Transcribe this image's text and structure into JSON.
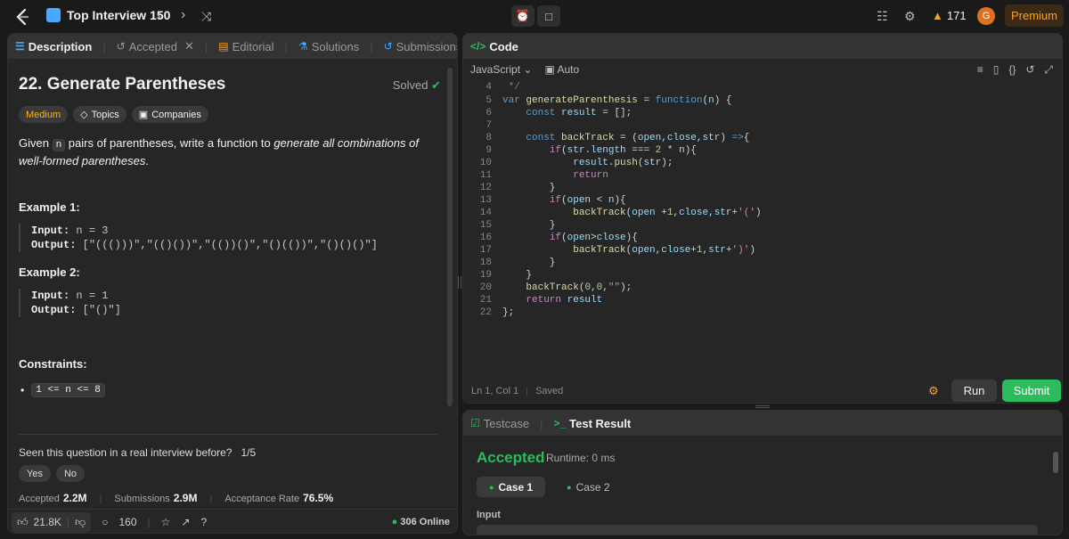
{
  "topbar": {
    "list_title": "Top Interview 150",
    "streak": "171",
    "avatar_initial": "G",
    "premium_label": "Premium"
  },
  "left_tabs": [
    {
      "label": "Description",
      "icon": "document-icon"
    },
    {
      "label": "Accepted",
      "icon": "history-icon"
    },
    {
      "label": "Editorial",
      "icon": "book-icon"
    },
    {
      "label": "Solutions",
      "icon": "flask-icon"
    },
    {
      "label": "Submissions",
      "icon": "clock-icon"
    }
  ],
  "problem": {
    "title": "22. Generate Parentheses",
    "solved_label": "Solved",
    "difficulty": "Medium",
    "topics_label": "Topics",
    "companies_label": "Companies",
    "desc_given": "Given ",
    "desc_n": "n",
    "desc_mid": " pairs of parentheses, write a function to ",
    "desc_em": "generate all combinations of well-formed parentheses",
    "desc_end": ".",
    "examples": [
      {
        "heading": "Example 1:",
        "input_label": "Input:",
        "input_value": "n = 3",
        "output_label": "Output:",
        "output_value": "[\"((()))\",\"(()())\",\"(())()\",\"()(())\",\"()()()\"]"
      },
      {
        "heading": "Example 2:",
        "input_label": "Input:",
        "input_value": "n = 1",
        "output_label": "Output:",
        "output_value": "[\"()\"]"
      }
    ],
    "constraints_heading": "Constraints:",
    "constraint": "1 <= n <= 8",
    "seen_question": "Seen this question in a real interview before?",
    "seen_count": "1/5",
    "yes_label": "Yes",
    "no_label": "No",
    "accepted_label": "Accepted",
    "accepted_value": "2.2M",
    "submissions_label": "Submissions",
    "submissions_value": "2.9M",
    "acceptance_label": "Acceptance Rate",
    "acceptance_value": "76.5%",
    "likes": "21.8K",
    "comments": "160",
    "online": "306 Online"
  },
  "code_panel": {
    "title": "Code",
    "language": "JavaScript",
    "auto_label": "Auto",
    "cursor_pos": "Ln 1, Col 1",
    "saved_label": "Saved",
    "run_label": "Run",
    "submit_label": "Submit"
  },
  "code_lines": [
    {
      "n": "4",
      "t": " */"
    },
    {
      "n": "5",
      "t": "var generateParenthesis = function(n) {"
    },
    {
      "n": "6",
      "t": "    const result = [];"
    },
    {
      "n": "7",
      "t": ""
    },
    {
      "n": "8",
      "t": "    const backTrack = (open,close,str) =>{"
    },
    {
      "n": "9",
      "t": "        if(str.length === 2 * n){"
    },
    {
      "n": "10",
      "t": "            result.push(str);"
    },
    {
      "n": "11",
      "t": "            return"
    },
    {
      "n": "12",
      "t": "        }"
    },
    {
      "n": "13",
      "t": "        if(open < n){"
    },
    {
      "n": "14",
      "t": "            backTrack(open +1,close,str+'(')"
    },
    {
      "n": "15",
      "t": "        }"
    },
    {
      "n": "16",
      "t": "        if(open>close){"
    },
    {
      "n": "17",
      "t": "            backTrack(open,close+1,str+')')"
    },
    {
      "n": "18",
      "t": "        }"
    },
    {
      "n": "19",
      "t": "    }"
    },
    {
      "n": "20",
      "t": "    backTrack(0,0,\"\");"
    },
    {
      "n": "21",
      "t": "    return result"
    },
    {
      "n": "22",
      "t": "};"
    }
  ],
  "result_panel": {
    "testcase_label": "Testcase",
    "test_result_label": "Test Result",
    "status": "Accepted",
    "runtime": "Runtime: 0 ms",
    "cases": [
      "Case 1",
      "Case 2"
    ],
    "input_label": "Input"
  },
  "colors": {
    "accent_green": "#2cbb5d",
    "medium_yellow": "#ffb800",
    "brand_orange": "#ffa116"
  }
}
